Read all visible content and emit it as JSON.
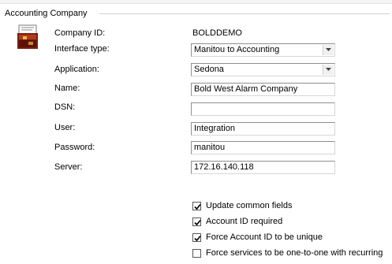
{
  "group": {
    "title": "Accounting Company"
  },
  "form": {
    "company_id": {
      "label": "Company ID:",
      "value": "BOLDDEMO"
    },
    "interface_type": {
      "label": "Interface type:",
      "value": "Manitou to Accounting"
    },
    "application": {
      "label": "Application:",
      "value": "Sedona"
    },
    "name": {
      "label": "Name:",
      "value": "Bold West Alarm Company"
    },
    "dsn": {
      "label": "DSN:",
      "value": ""
    },
    "user": {
      "label": "User:",
      "value": "Integration"
    },
    "password": {
      "label": "Password:",
      "value": "manitou"
    },
    "server": {
      "label": "Server:",
      "value": "172.16.140.118"
    }
  },
  "checkboxes": [
    {
      "label": "Update common fields",
      "checked": true
    },
    {
      "label": "Account ID required",
      "checked": true
    },
    {
      "label": "Force Account ID to be unique",
      "checked": true
    },
    {
      "label": "Force services to be one-to-one with recurring",
      "checked": false
    }
  ],
  "icons": {
    "company": "accounting-company-icon",
    "dropdown": "chevron-down-icon",
    "check": "checkmark-icon"
  },
  "colors": {
    "field_border": "#8f8f8f",
    "group_line": "#d0d0d0"
  }
}
